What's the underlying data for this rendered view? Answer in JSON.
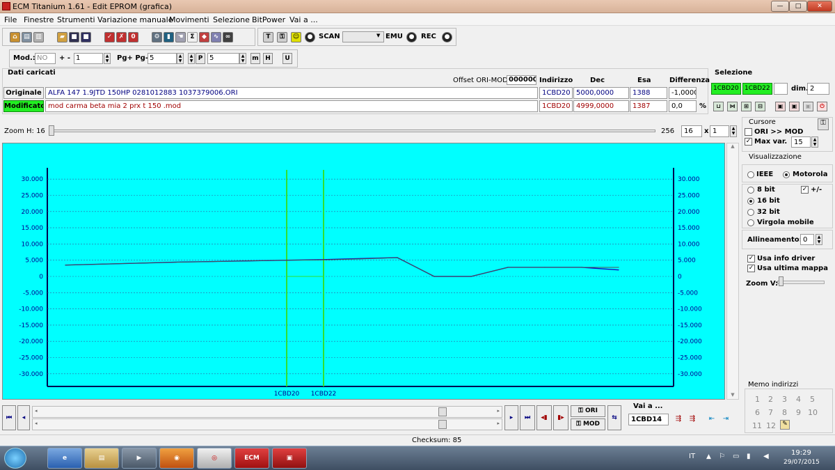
{
  "window": {
    "title": "ECM Titanium 1.61 - Edit EPROM (grafica)",
    "min": "—",
    "max": "□",
    "close": "✕"
  },
  "menu": [
    "File",
    "Finestre",
    "Strumenti",
    "Variazione manuale",
    "Movimenti",
    "Selezione",
    "BitPower",
    "Vai a ..."
  ],
  "toolbar": {
    "scan_label": "SCAN",
    "emu_label": "EMU",
    "rec_label": "REC",
    "scan_value": ""
  },
  "toolbar2": {
    "mod_label": "Mod.:",
    "mod_value": "NO",
    "plusminus_label": "+ -",
    "plusminus_value": "1",
    "page_label": "Pg+ Pg-",
    "page_value": "5",
    "p_icon": "P",
    "p_value": "5",
    "m_icon": "m",
    "h_icon": "H",
    "u_icon": "U"
  },
  "dati": {
    "title": "Dati caricati",
    "offset_label": "Offset ORI-MOD",
    "offset_value": "000000",
    "col_indirizzo": "Indirizzo",
    "col_dec": "Dec",
    "col_esa": "Esa",
    "col_diff": "Differenza",
    "originale": {
      "label": "Originale",
      "name": "ALFA 147 1.9JTD 150HP 0281012883 1037379006.ORI",
      "indirizzo": "1CBD20",
      "dec": "5000,0000",
      "esa": "1388",
      "diff": "-1,0000"
    },
    "modificato": {
      "label": "Modificato",
      "name": "mod carma beta mia 2 prx t 150 .mod",
      "indirizzo": "1CBD20",
      "dec": "4999,0000",
      "esa": "1387",
      "diff": "0,0",
      "unit": "%"
    }
  },
  "selezione": {
    "title": "Selezione",
    "start": "1CBD20",
    "end": "1CBD22",
    "dim_label": "dim.",
    "dim_value": "2"
  },
  "zoom": {
    "label": "Zoom H: 16",
    "max": "256",
    "value": "16",
    "x_label": "x",
    "mult": "1"
  },
  "cursore": {
    "title": "Cursore",
    "ori_mod": "ORI >> MOD",
    "max_var": "Max var.",
    "max_var_value": "15"
  },
  "visualizzazione": {
    "title": "Visualizzazione",
    "ieee": "IEEE",
    "motorola": "Motorola",
    "bit8": "8 bit",
    "pm": "+/-",
    "bit16": "16 bit",
    "bit32": "32 bit",
    "virgola": "Virgola mobile",
    "allineamento": "Allineamento:",
    "allineamento_value": "0",
    "usa_info": "Usa info driver",
    "usa_ultima": "Usa ultima mappa",
    "zoomv": "Zoom V:"
  },
  "memo": {
    "title": "Memo indirizzi",
    "numbers": [
      "1",
      "2",
      "3",
      "4",
      "5",
      "6",
      "7",
      "8",
      "9",
      "10",
      "11",
      "12"
    ]
  },
  "nav": {
    "ori": "ORI",
    "mod": "MOD",
    "vaia_label": "Vai a ...",
    "vaia_value": "1CBD14"
  },
  "status": {
    "checksum": "Checksum: 85"
  },
  "tray": {
    "lang": "IT",
    "time": "19:29",
    "date": "29/07/2015"
  },
  "chart_data": {
    "type": "line",
    "ylim": [
      -32500,
      35000
    ],
    "yticks": [
      "30.000",
      "25.000",
      "20.000",
      "15.000",
      "10.000",
      "5.000",
      "0",
      "-5.000",
      "-10.000",
      "-15.000",
      "-20.000",
      "-25.000",
      "-30.000"
    ],
    "ytick_values": [
      30000,
      25000,
      20000,
      15000,
      10000,
      5000,
      0,
      -5000,
      -10000,
      -15000,
      -20000,
      -25000,
      -30000
    ],
    "xlim": [
      0,
      16
    ],
    "markers": [
      {
        "label": "1CBD20",
        "x": 6
      },
      {
        "label": "1CBD22",
        "x": 7
      }
    ],
    "series": [
      {
        "color": "#1010c0",
        "x": [
          0,
          1,
          2,
          3,
          4,
          5,
          6,
          7,
          8,
          9,
          10,
          11,
          12,
          13,
          14,
          15
        ],
        "y": [
          3500,
          3800,
          4100,
          4400,
          4600,
          4800,
          5000,
          5200,
          5500,
          5800,
          0,
          0,
          2800,
          2800,
          2800,
          2000
        ]
      },
      {
        "color": "#505050",
        "x": [
          0,
          1,
          2,
          3,
          4,
          5,
          6,
          7,
          8,
          9,
          10,
          11,
          12,
          13,
          14,
          15
        ],
        "y": [
          3500,
          3800,
          4100,
          4400,
          4600,
          4800,
          4999,
          5100,
          5400,
          5800,
          0,
          0,
          2800,
          2800,
          2800,
          2800
        ]
      }
    ]
  }
}
